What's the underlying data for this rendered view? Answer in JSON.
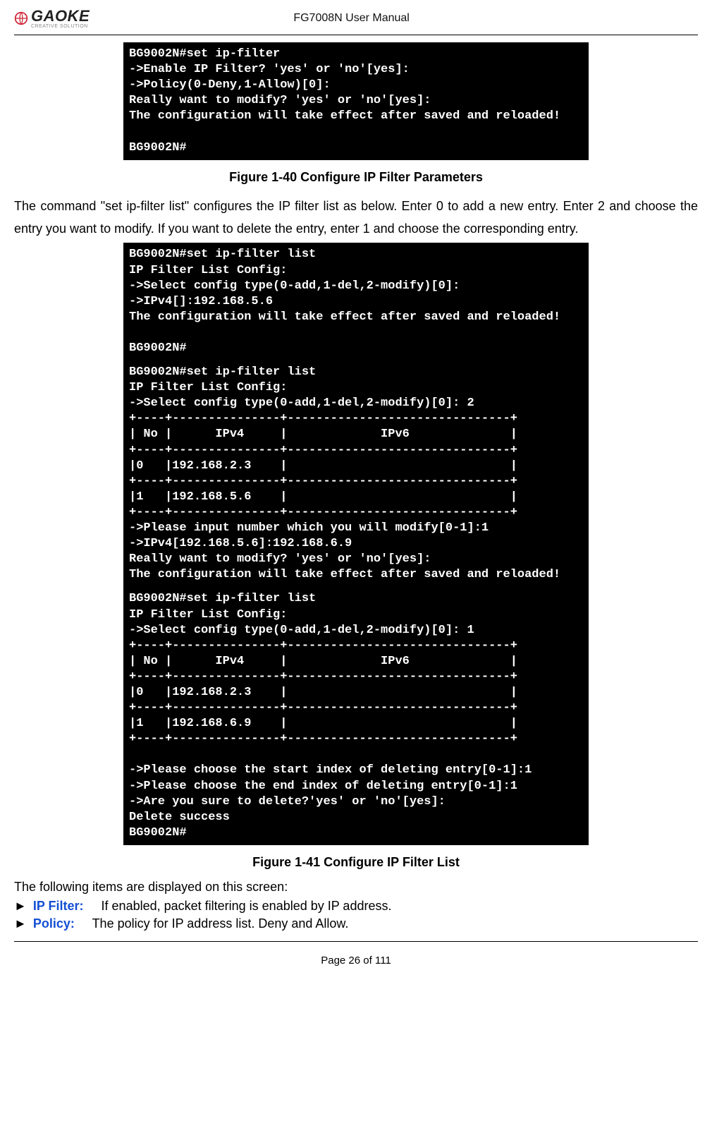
{
  "header": {
    "logo_main": "GAOKE",
    "logo_sub": "CREATIVE SOLUTION",
    "doc_title": "FG7008N User Manual"
  },
  "terminal1": "BG9002N#set ip-filter\n->Enable IP Filter? 'yes' or 'no'[yes]:\n->Policy(0-Deny,1-Allow)[0]:\nReally want to modify? 'yes' or 'no'[yes]:\nThe configuration will take effect after saved and reloaded!\n\nBG9002N#",
  "caption1": "Figure 1-40   Configure IP Filter Parameters",
  "body1": "The command \"set ip-filter list\" configures the IP filter list as below. Enter 0 to add a new entry. Enter 2 and choose the entry you want to modify. If you want to delete the entry, enter 1 and choose the corresponding entry.",
  "terminal2": "BG9002N#set ip-filter list\nIP Filter List Config:\n->Select config type(0-add,1-del,2-modify)[0]:\n->IPv4[]:192.168.5.6\nThe configuration will take effect after saved and reloaded!\n\nBG9002N#",
  "terminal3": "BG9002N#set ip-filter list\nIP Filter List Config:\n->Select config type(0-add,1-del,2-modify)[0]: 2\n+----+---------------+-------------------------------+\n| No |      IPv4     |             IPv6              |\n+----+---------------+-------------------------------+\n|0   |192.168.2.3    |                               |\n+----+---------------+-------------------------------+\n|1   |192.168.5.6    |                               |\n+----+---------------+-------------------------------+\n->Please input number which you will modify[0-1]:1\n->IPv4[192.168.5.6]:192.168.6.9\nReally want to modify? 'yes' or 'no'[yes]:\nThe configuration will take effect after saved and reloaded!",
  "terminal4": "BG9002N#set ip-filter list\nIP Filter List Config:\n->Select config type(0-add,1-del,2-modify)[0]: 1\n+----+---------------+-------------------------------+\n| No |      IPv4     |             IPv6              |\n+----+---------------+-------------------------------+\n|0   |192.168.2.3    |                               |\n+----+---------------+-------------------------------+\n|1   |192.168.6.9    |                               |\n+----+---------------+-------------------------------+\n\n->Please choose the start index of deleting entry[0-1]:1\n->Please choose the end index of deleting entry[0-1]:1\n->Are you sure to delete?'yes' or 'no'[yes]:\nDelete success\nBG9002N#",
  "caption2": "Figure 1-41   Configure IP Filter List",
  "items_intro": "The following items are displayed on this screen:",
  "items": [
    {
      "bullet": "►",
      "label": "IP Filter:",
      "desc": " If enabled, packet filtering is enabled by IP address."
    },
    {
      "bullet": "►",
      "label": "Policy:",
      "desc": "The policy for IP address list. Deny and Allow."
    }
  ],
  "page_num": "Page 26 of 111"
}
